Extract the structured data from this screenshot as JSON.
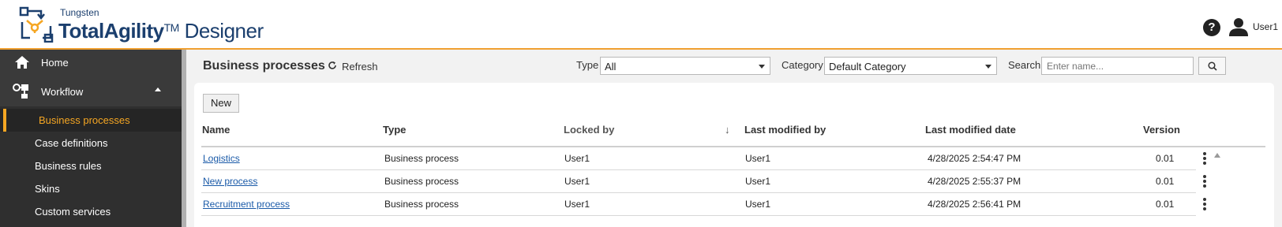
{
  "header": {
    "brand_top": "Tungsten",
    "brand_bold": "TotalAgility",
    "brand_tm": "TM",
    "brand_rest": " Designer",
    "help_icon": "help-circle-icon",
    "user_icon": "user-icon",
    "user_name": "User1"
  },
  "sidebar": {
    "home_label": "Home",
    "workflow_label": "Workflow",
    "items": [
      {
        "label": "Business processes",
        "active": true
      },
      {
        "label": "Case definitions",
        "active": false
      },
      {
        "label": "Business rules",
        "active": false
      },
      {
        "label": "Skins",
        "active": false
      },
      {
        "label": "Custom services",
        "active": false
      }
    ]
  },
  "toolbar": {
    "title": "Business processes",
    "refresh_label": "Refresh",
    "type_label": "Type",
    "type_value": "All",
    "category_label": "Category",
    "category_value": "Default Category",
    "search_label": "Search",
    "search_placeholder": "Enter name..."
  },
  "table": {
    "new_label": "New",
    "columns": [
      "Name",
      "Type",
      "Locked by",
      "Last modified by",
      "Last modified date",
      "Version"
    ],
    "sort_arrow": "↓",
    "rows": [
      {
        "name": "Logistics",
        "type": "Business process",
        "locked_by": "User1",
        "modified_by": "User1",
        "modified_date": "4/28/2025 2:54:47 PM",
        "version": "0.01"
      },
      {
        "name": "New process",
        "type": "Business process",
        "locked_by": "User1",
        "modified_by": "User1",
        "modified_date": "4/28/2025 2:55:37 PM",
        "version": "0.01"
      },
      {
        "name": "Recruitment process",
        "type": "Business process",
        "locked_by": "User1",
        "modified_by": "User1",
        "modified_date": "4/28/2025 2:56:41 PM",
        "version": "0.01"
      }
    ]
  },
  "colors": {
    "accent": "#f5a623",
    "brand": "#1b3f6e",
    "sidebar_bg": "#2f2f2f",
    "link": "#1a5aa8"
  }
}
